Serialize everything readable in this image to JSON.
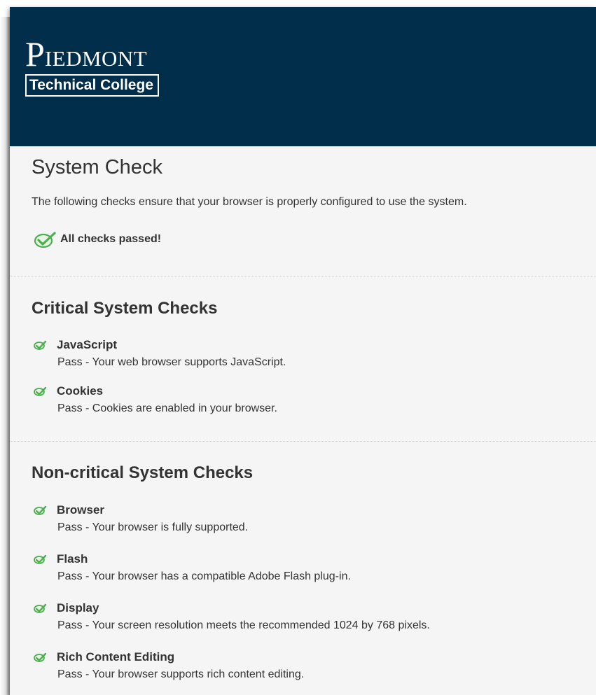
{
  "header": {
    "logo_initial": "P",
    "logo_rest": "IEDMONT",
    "logo_sub": "Technical College",
    "bg_color": "#002e4b"
  },
  "page": {
    "title": "System Check",
    "intro": "The following checks ensure that your browser is properly configured to use the system.",
    "summary": "All checks passed!",
    "summary_icon": "check-circle-icon",
    "accent_color": "#4caf50"
  },
  "sections": [
    {
      "title": "Critical System Checks",
      "checks": [
        {
          "name": "JavaScript",
          "description": "Pass - Your web browser supports JavaScript.",
          "icon": "check-icon"
        },
        {
          "name": "Cookies",
          "description": "Pass - Cookies are enabled in your browser.",
          "icon": "check-icon"
        }
      ]
    },
    {
      "title": "Non-critical System Checks",
      "checks": [
        {
          "name": "Browser",
          "description": "Pass - Your browser is fully supported.",
          "icon": "check-icon"
        },
        {
          "name": "Flash",
          "description": "Pass - Your browser has a compatible Adobe Flash plug-in.",
          "icon": "check-icon"
        },
        {
          "name": "Display",
          "description": "Pass - Your screen resolution meets the recommended 1024 by 768 pixels.",
          "icon": "check-icon"
        },
        {
          "name": "Rich Content Editing",
          "description": "Pass - Your browser supports rich content editing.",
          "icon": "check-icon"
        }
      ]
    }
  ]
}
